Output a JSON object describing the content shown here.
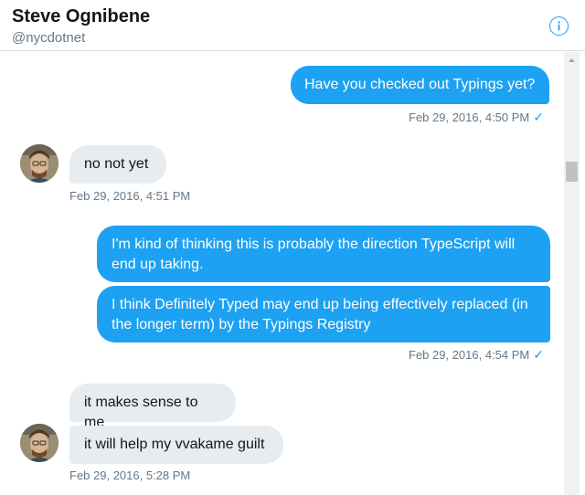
{
  "header": {
    "name": "Steve Ognibene",
    "handle": "@nycdotnet"
  },
  "messages": [
    {
      "text": "Have you checked out Typings yet?",
      "timestamp": "Feb 29, 2016, 4:50 PM",
      "direction": "out"
    },
    {
      "text": "no not yet",
      "timestamp": "Feb 29, 2016, 4:51 PM",
      "direction": "in"
    },
    {
      "text": "I'm kind of thinking this is probably the direction TypeScript will end up taking.",
      "direction": "out"
    },
    {
      "text": "I think Definitely Typed may end up being effectively replaced (in the longer term) by the Typings Registry",
      "timestamp": "Feb 29, 2016, 4:54 PM",
      "direction": "out"
    },
    {
      "text": "it makes sense to me",
      "direction": "in"
    },
    {
      "text": "it will help my vvakame guilt",
      "timestamp": "Feb 29, 2016, 5:28 PM",
      "direction": "in"
    }
  ],
  "icons": {
    "info": "info-icon",
    "read_receipt": "checkmark-icon",
    "read_receipt_glyph": "✓"
  },
  "colors": {
    "accent": "#1da1f2",
    "incoming_bubble": "#e6ecf0",
    "muted_text": "#657786"
  }
}
